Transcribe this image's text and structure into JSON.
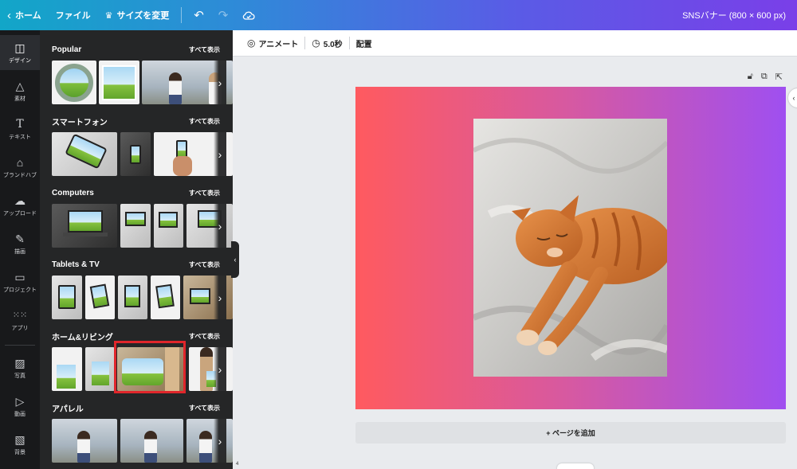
{
  "topbar": {
    "home_label": "ホーム",
    "file_label": "ファイル",
    "resize_label": "サイズを変更",
    "doc_title": "SNSバナー (800 × 600 px)"
  },
  "rail": {
    "items": [
      {
        "label": "デザイン",
        "icon": "layout-icon"
      },
      {
        "label": "素材",
        "icon": "shapes-icon"
      },
      {
        "label": "テキスト",
        "icon": "text-icon"
      },
      {
        "label": "ブランドハブ",
        "icon": "brand-icon"
      },
      {
        "label": "アップロード",
        "icon": "cloud-upload-icon"
      },
      {
        "label": "描画",
        "icon": "draw-icon"
      },
      {
        "label": "プロジェクト",
        "icon": "folder-icon"
      },
      {
        "label": "アプリ",
        "icon": "apps-grid-icon"
      },
      {
        "label": "写真",
        "icon": "photo-icon"
      },
      {
        "label": "動画",
        "icon": "video-icon"
      },
      {
        "label": "背景",
        "icon": "background-icon"
      }
    ]
  },
  "panel": {
    "see_all": "すべて表示",
    "sections": [
      {
        "title": "Popular"
      },
      {
        "title": "スマートフォン"
      },
      {
        "title": "Computers"
      },
      {
        "title": "Tablets & TV"
      },
      {
        "title": "ホーム&リビング"
      },
      {
        "title": "アパレル"
      }
    ]
  },
  "editor": {
    "animate_label": "アニメート",
    "duration_label": "5.0秒",
    "position_label": "配置",
    "add_page_label": "+ ページを追加",
    "page_number": "4"
  },
  "colors": {
    "gradient_start": "#ff5a5f",
    "gradient_end": "#9f4ff0",
    "highlight": "#e0262b"
  }
}
